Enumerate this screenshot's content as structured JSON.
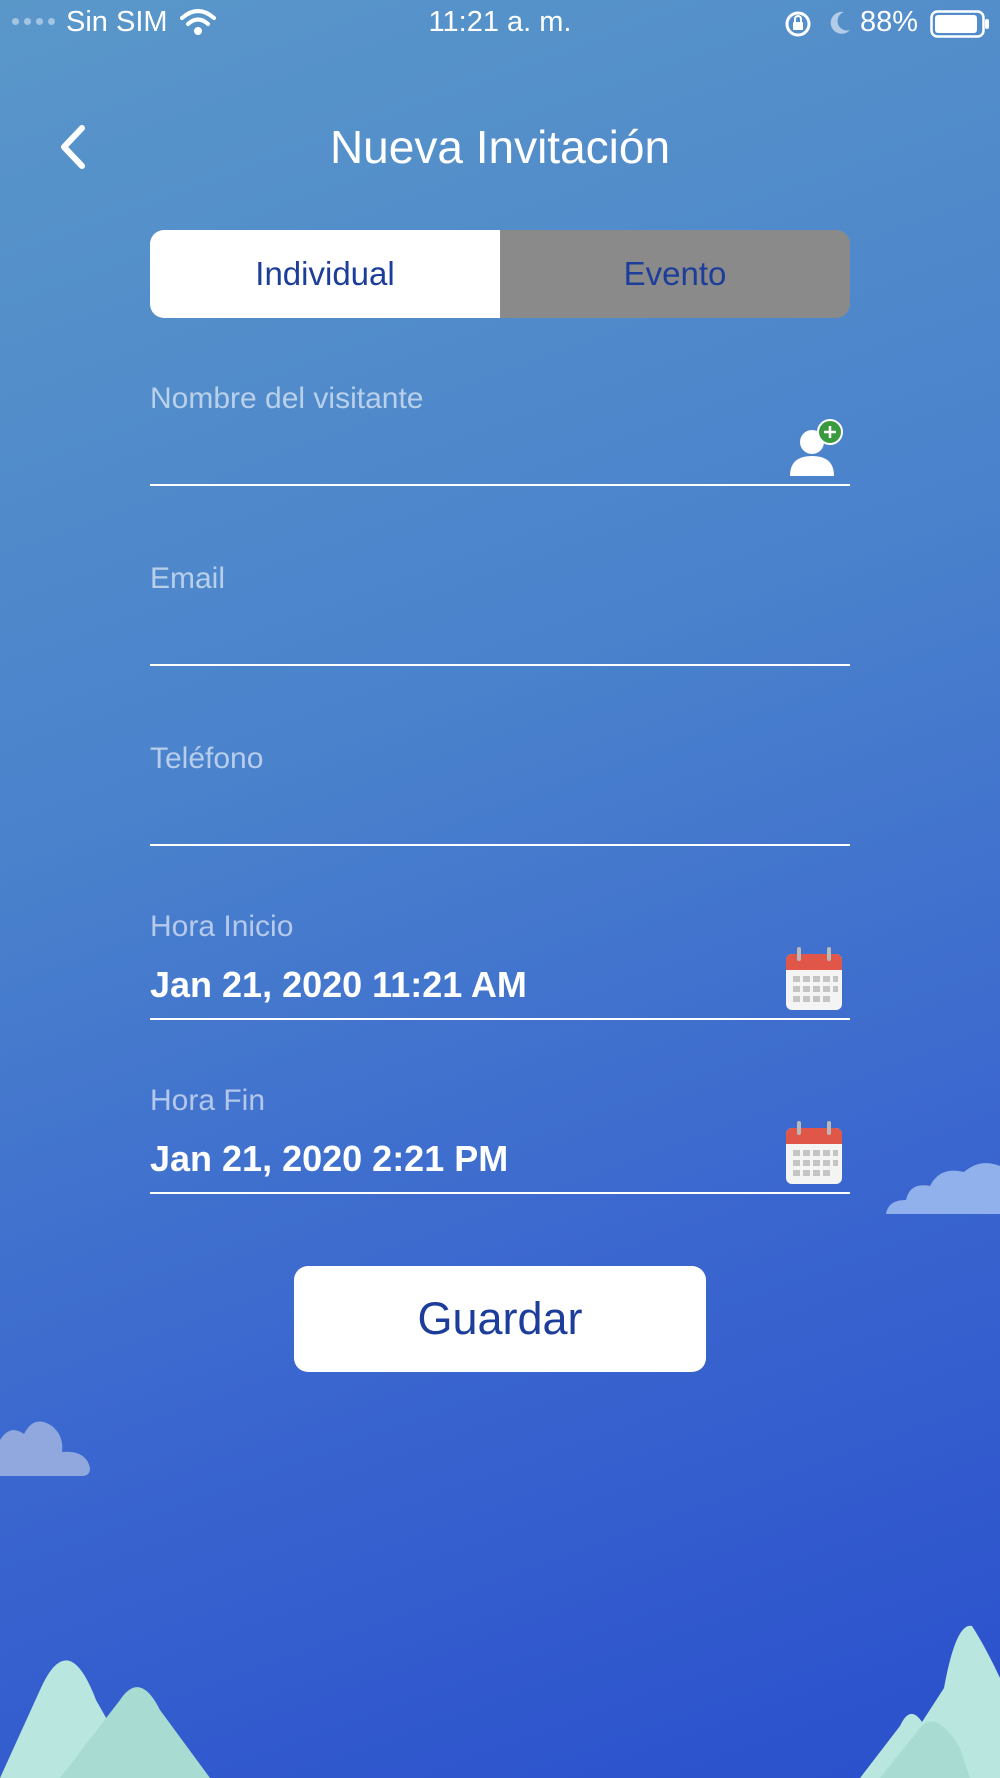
{
  "status_bar": {
    "carrier": "Sin SIM",
    "time": "11:21 a. m.",
    "battery": "88%",
    "icons": [
      "signal-dots-icon",
      "wifi-icon",
      "rotation-lock-icon",
      "moon-icon",
      "battery-icon"
    ]
  },
  "header": {
    "title": "Nueva Invitación",
    "back_icon": "chevron-left-icon"
  },
  "tabs": [
    {
      "label": "Individual",
      "active": true
    },
    {
      "label": "Evento",
      "active": false
    }
  ],
  "form": {
    "visitor_name": {
      "label": "Nombre del visitante",
      "value": "",
      "icon": "add-contact-icon"
    },
    "email": {
      "label": "Email",
      "value": ""
    },
    "phone": {
      "label": "Teléfono",
      "value": ""
    },
    "start": {
      "label": "Hora Inicio",
      "value": "Jan 21, 2020 11:21 AM",
      "icon": "calendar-icon"
    },
    "end": {
      "label": "Hora Fin",
      "value": "Jan 21, 2020 2:21 PM",
      "icon": "calendar-icon"
    }
  },
  "save_button": {
    "label": "Guardar"
  },
  "colors": {
    "accent": "#1d3d9a",
    "inactive_tab": "#8a8a8a",
    "add_badge": "#3a9a3e",
    "calendar_red": "#e05648"
  }
}
